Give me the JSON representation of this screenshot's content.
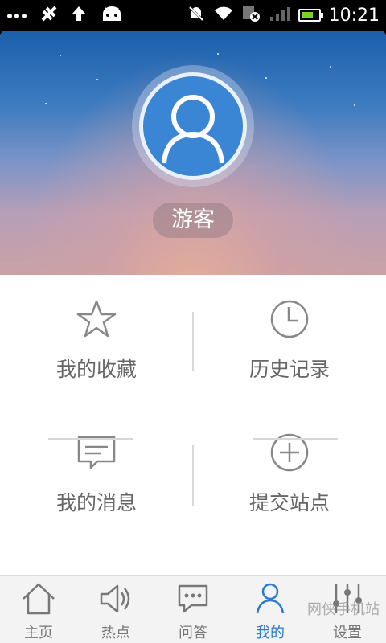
{
  "status_bar": {
    "time": "10:21",
    "icons": [
      "more-icon",
      "usb-icon",
      "upload-icon",
      "android-icon",
      "mute-icon",
      "wifi-icon",
      "data-icon",
      "signal-icon",
      "battery-icon"
    ]
  },
  "profile": {
    "username": "游客",
    "avatar_icon": "user-icon"
  },
  "menu": [
    {
      "label": "我的收藏",
      "icon": "star-icon"
    },
    {
      "label": "历史记录",
      "icon": "clock-icon"
    },
    {
      "label": "我的消息",
      "icon": "message-icon"
    },
    {
      "label": "提交站点",
      "icon": "add-icon"
    }
  ],
  "nav": [
    {
      "label": "主页",
      "icon": "home-icon"
    },
    {
      "label": "热点",
      "icon": "speaker-icon"
    },
    {
      "label": "问答",
      "icon": "chat-icon"
    },
    {
      "label": "我的",
      "icon": "person-icon",
      "active": true
    },
    {
      "label": "设置",
      "icon": "sliders-icon"
    }
  ],
  "watermark": "网侠手机站",
  "colors": {
    "accent": "#2a7ad2",
    "avatar": "#3a86d4",
    "battery": "#7ed321"
  }
}
